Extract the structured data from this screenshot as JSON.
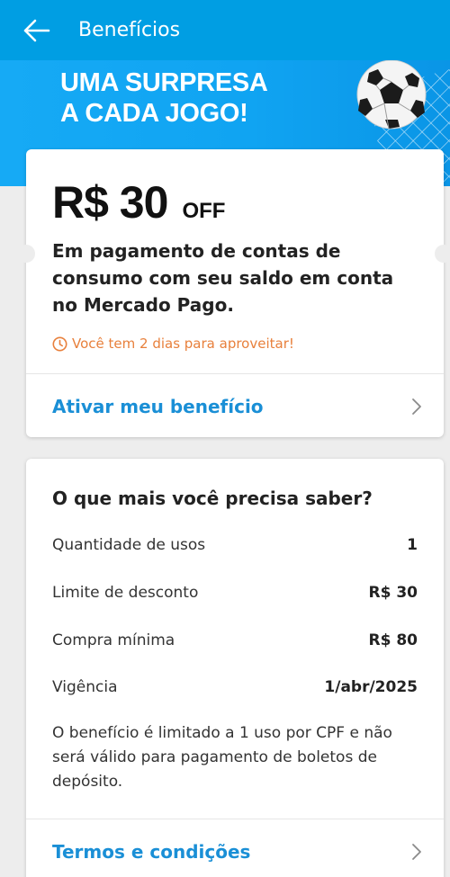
{
  "appbar": {
    "title": "Benefícios",
    "back_icon": "arrow-left-icon"
  },
  "banner": {
    "line1": "UMA SURPRESA",
    "line2": "A CADA JOGO!",
    "art": "soccer-ball-net"
  },
  "offer": {
    "amount": "R$ 30",
    "suffix": "OFF",
    "description": "Em pagamento de contas de consumo com seu saldo em conta no Mercado Pago.",
    "deadline": "Você tem 2 dias para aproveitar!",
    "action_label": "Ativar meu benefício"
  },
  "info": {
    "title": "O que mais você precisa saber?",
    "rows": [
      {
        "label": "Quantidade de usos",
        "value": "1"
      },
      {
        "label": "Limite de desconto",
        "value": "R$ 30"
      },
      {
        "label": "Compra mínima",
        "value": "R$ 80"
      },
      {
        "label": "Vigência",
        "value": "1/abr/2025"
      }
    ],
    "note": "O benefício é limitado a 1 uso por CPF e não será válido para pagamento de boletos de depósito.",
    "terms_label": "Termos e condições"
  },
  "colors": {
    "appbar": "#009ee3",
    "link": "#1a8fd6",
    "deadline": "#e8803c",
    "background": "#ededed"
  }
}
